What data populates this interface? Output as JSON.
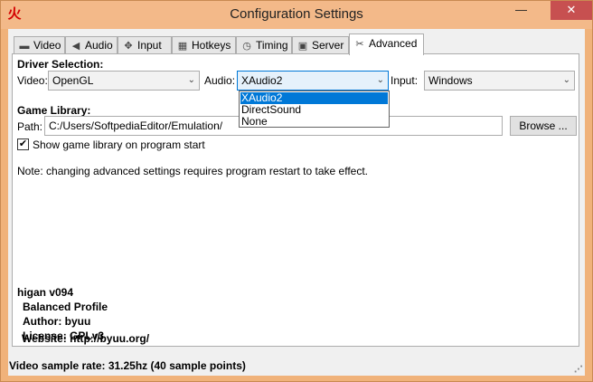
{
  "window": {
    "title": "Configuration Settings",
    "app_icon_glyph": "火",
    "minimize_glyph": "—",
    "maximize_glyph": "☐",
    "close_glyph": "✕"
  },
  "tabs": [
    {
      "label": "Video",
      "icon": "monitor-icon",
      "glyph": "▬"
    },
    {
      "label": "Audio",
      "icon": "speaker-icon",
      "glyph": "◀"
    },
    {
      "label": "Input",
      "icon": "joystick-icon",
      "glyph": "✥"
    },
    {
      "label": "Hotkeys",
      "icon": "keyboard-icon",
      "glyph": "▦"
    },
    {
      "label": "Timing",
      "icon": "clock-icon",
      "glyph": "◷"
    },
    {
      "label": "Server",
      "icon": "server-icon",
      "glyph": "▣"
    },
    {
      "label": "Advanced",
      "icon": "tools-icon",
      "glyph": "✂",
      "active": true
    }
  ],
  "driver": {
    "heading": "Driver Selection:",
    "video_label": "Video:",
    "video_value": "OpenGL",
    "audio_label": "Audio:",
    "audio_value": "XAudio2",
    "audio_options": [
      "XAudio2",
      "DirectSound",
      "None"
    ],
    "input_label": "Input:",
    "input_value": "Windows"
  },
  "library": {
    "heading": "Game Library:",
    "path_label": "Path:",
    "path_value": "C:/Users/SoftpediaEditor/Emulation/",
    "browse_label": "Browse ...",
    "show_label": "Show game library on program start",
    "show_checked": true
  },
  "note": "Note: changing advanced settings requires program restart to take effect.",
  "info": {
    "name": "higan v094",
    "profile": "Balanced Profile",
    "author": "Author: byuu",
    "license": "License: GPLv3",
    "website": "Website: http://byuu.org/"
  },
  "status": "Video sample rate: 31.25hz (40 sample points)"
}
